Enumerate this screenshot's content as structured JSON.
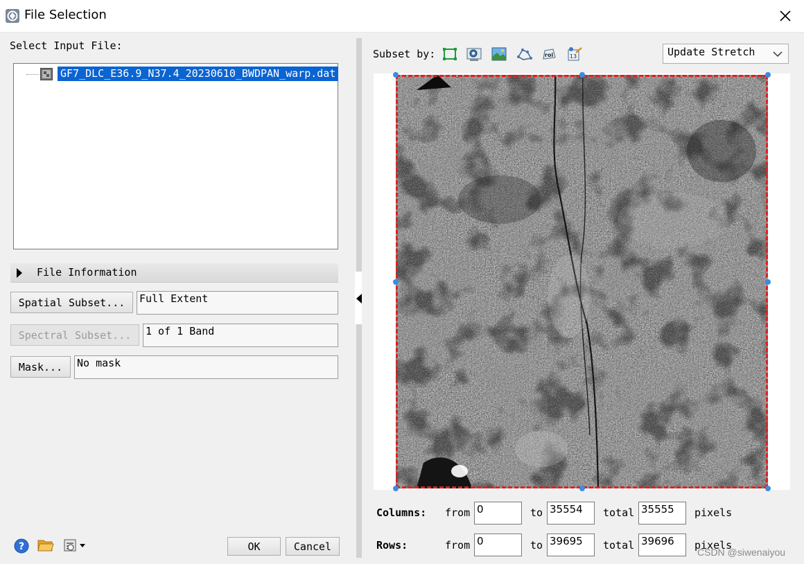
{
  "window": {
    "title": "File Selection",
    "icon": "envi-app-icon",
    "close_icon": "close-icon"
  },
  "left": {
    "select_label": "Select Input File:",
    "files": [
      {
        "name": "GF7_DLC_E36.9_N37.4_20230610_BWDPAN_warp.dat",
        "selected": true,
        "icon": "raster-file-icon"
      }
    ],
    "file_info_label": "File Information",
    "spatial_subset_button": "Spatial Subset...",
    "spatial_subset_value": "Full Extent",
    "spectral_subset_button": "Spectral Subset...",
    "spectral_subset_value": "1 of 1 Band",
    "mask_button": "Mask...",
    "mask_value": "No mask"
  },
  "footer": {
    "help_icon": "help-icon",
    "open_icon": "folder-open-icon",
    "options_icon": "options-dropdown-icon",
    "ok": "OK",
    "cancel": "Cancel"
  },
  "right": {
    "subset_by_label": "Subset by:",
    "subset_tools": [
      "full-extent-icon",
      "view-extent-icon",
      "image-extent-icon",
      "vector-extent-icon",
      "roi-extent-icon",
      "file-subset-icon"
    ],
    "stretch_selected": "Update Stretch",
    "columns_label": "Columns:",
    "rows_label": "Rows:",
    "from_label": "from",
    "to_label": "to",
    "total_label": "total",
    "pixels_label": "pixels",
    "columns": {
      "from": "0",
      "to": "35554",
      "total": "35555"
    },
    "rows": {
      "from": "0",
      "to": "39695",
      "total": "39696"
    }
  },
  "colors": {
    "selection": "#0a64d2",
    "subset_box": "#e02020",
    "handle": "#3a8de0"
  },
  "watermark": "CSDN @siwenaiyou"
}
